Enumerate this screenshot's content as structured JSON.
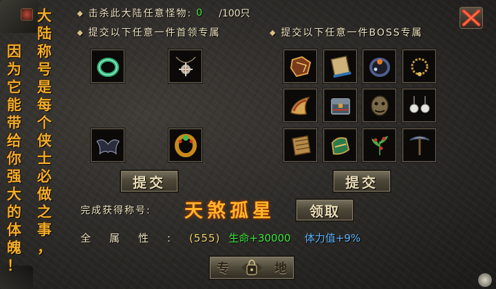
{
  "quest": {
    "kill_text": "击杀此大陆任意怪物:",
    "kill_count": "0",
    "kill_total": "/100只",
    "submit_left_text": "提交以下任意一件首领专属",
    "submit_right_text": "提交以下任意一件BOSS专属"
  },
  "slogan": {
    "left_column": [
      "因",
      "为",
      "它",
      "能",
      "带",
      "给",
      "你",
      "强",
      "大",
      "的",
      "体",
      "魄",
      "！"
    ],
    "right_column": [
      "大",
      "陆",
      "称",
      "号",
      "是",
      "每",
      "个",
      "侠",
      "士",
      "必",
      "做",
      "之",
      "事",
      "，"
    ]
  },
  "buttons": {
    "submit_left": "提交",
    "submit_right": "提交",
    "claim": "领取"
  },
  "reward": {
    "label": "完成获得称号:",
    "title": "天煞孤星"
  },
  "stats": {
    "label": "全属性:",
    "all_attr": "(555)",
    "hp": "生命+30000",
    "stamina": "体力值+9%"
  },
  "bottom_bar": {
    "left_char": "专",
    "right_char": "地"
  },
  "items": {
    "left": [
      "jade-ring-icon",
      "skull-necklace-icon",
      "bat-wing-icon",
      "gold-ring-icon"
    ],
    "right": [
      "armor-piece-icon",
      "scroll-icon",
      "dark-bracelet-icon",
      "bead-necklace-icon",
      "horn-icon",
      "chest-icon",
      "monster-head-icon",
      "pearl-earrings-icon",
      "hide-scroll-icon",
      "gauntlet-icon",
      "herb-icon",
      "pickaxe-icon"
    ]
  },
  "colors": {
    "slogan": "#f2ad2a",
    "kill_count": "#3ee83e",
    "hp": "#3ee83e",
    "stamina": "#5fb4ff",
    "title": "#ffb52a"
  }
}
